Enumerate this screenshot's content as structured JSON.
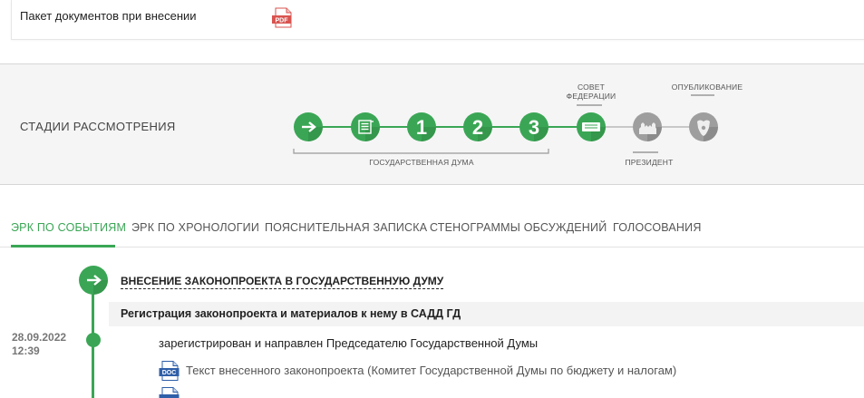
{
  "package": {
    "label": "Пакет документов при внесении",
    "file_badge": "PDF"
  },
  "stages": {
    "title": "СТАДИИ РАССМОТРЕНИЯ",
    "steps": [
      "1",
      "2",
      "3"
    ],
    "duma_label": "ГОСУДАРСТВЕННАЯ ДУМА",
    "council_label_line1": "СОВЕТ",
    "council_label_line2": "ФЕДЕРАЦИИ",
    "publication_label": "ОПУБЛИКОВАНИЕ",
    "president_label": "ПРЕЗИДЕНТ",
    "colors": {
      "done": "#3aa655",
      "done_dark": "#2f8a44",
      "pending": "#9e9e9e",
      "line_done": "#3aa655",
      "line_pending": "#c8c8c8"
    },
    "progress_completed_stages": 5
  },
  "tabs": [
    {
      "label": "ЭРК ПО СОБЫТИЯМ",
      "active": true
    },
    {
      "label": "ЭРК ПО ХРОНОЛОГИИ"
    },
    {
      "label": "ПОЯСНИТЕЛЬНАЯ ЗАПИСКА"
    },
    {
      "label": "СТЕНОГРАММЫ ОБСУЖДЕНИЙ"
    },
    {
      "label": "ГОЛОСОВАНИЯ"
    }
  ],
  "timeline": {
    "event_title": "ВНЕСЕНИЕ ЗАКОНОПРОЕКТА В ГОСУДАРСТВЕННУЮ ДУМУ",
    "substage": "Регистрация законопроекта и материалов к нему в САДД ГД",
    "date": "28.09.2022",
    "time": "12:39",
    "status": "зарегистрирован и направлен Председателю Государственной Думы",
    "doc_badge": "DOC",
    "documents": [
      "Текст внесенного законопроекта (Комитет Государственной Думы по бюджету и налогам)"
    ]
  }
}
